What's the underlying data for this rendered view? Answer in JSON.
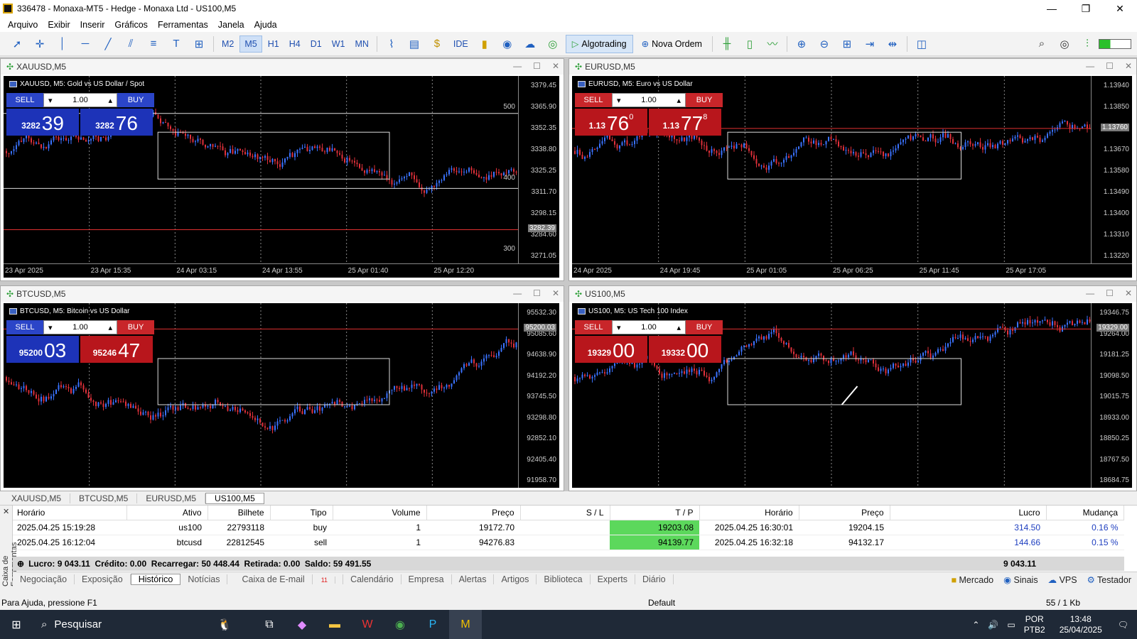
{
  "window": {
    "title": "336478 - Monaxa-MT5 - Hedge - Monaxa Ltd - US100,M5",
    "minimize": "—",
    "restore": "❐",
    "close": "✕"
  },
  "menu": [
    "Arquivo",
    "Exibir",
    "Inserir",
    "Gráficos",
    "Ferramentas",
    "Janela",
    "Ajuda"
  ],
  "toolbar": {
    "timeframes": [
      "M2",
      "M5",
      "H1",
      "H4",
      "D1",
      "W1",
      "MN"
    ],
    "active_tf": "M5",
    "ide": "IDE",
    "algotrading": "Algotrading",
    "nova_ordem": "Nova Ordem"
  },
  "charts": [
    {
      "id": "xau",
      "caption": "XAUUSD,M5",
      "symbol_label": "XAUUSD, M5:  Gold vs US Dollar / Spot",
      "style": "blue",
      "lot": "1.00",
      "sell": "SELL",
      "buy": "BUY",
      "sell_small": "3282",
      "sell_big": "39",
      "sell_sup": "",
      "buy_small": "3282",
      "buy_big": "76",
      "buy_sup": "",
      "yticks": [
        "3379.45",
        "3365.90",
        "3352.35",
        "3338.80",
        "3325.25",
        "3311.70",
        "3298.15",
        "3284.60",
        "3271.05"
      ],
      "current": "3282.39",
      "xticks": [
        "23 Apr 2025",
        "23 Apr 15:35",
        "24 Apr 03:15",
        "24 Apr 13:55",
        "25 Apr 01:40",
        "25 Apr 12:20"
      ],
      "levels": [
        "500",
        "400",
        "300"
      ]
    },
    {
      "id": "eur",
      "caption": "EURUSD,M5",
      "symbol_label": "EURUSD, M5:  Euro vs US Dollar",
      "style": "red",
      "lot": "1.00",
      "sell": "SELL",
      "buy": "BUY",
      "sell_small": "1.13",
      "sell_big": "76",
      "sell_sup": "0",
      "buy_small": "1.13",
      "buy_big": "77",
      "buy_sup": "8",
      "yticks": [
        "1.13940",
        "1.13850",
        "1.13760",
        "1.13670",
        "1.13580",
        "1.13490",
        "1.13400",
        "1.13310",
        "1.13220"
      ],
      "current": "1.13760",
      "xticks": [
        "24 Apr 2025",
        "24 Apr 19:45",
        "25 Apr 01:05",
        "25 Apr 06:25",
        "25 Apr 11:45",
        "25 Apr 17:05"
      ],
      "levels": []
    },
    {
      "id": "btc",
      "caption": "BTCUSD,M5",
      "symbol_label": "BTCUSD, M5:  Bitcoin vs US Dollar",
      "style": "mix",
      "lot": "1.00",
      "sell": "SELL",
      "buy": "BUY",
      "sell_small": "95200",
      "sell_big": "03",
      "sell_sup": "",
      "buy_small": "95246",
      "buy_big": "47",
      "buy_sup": "",
      "yticks": [
        "95532.30",
        "95085.60",
        "94638.90",
        "94192.20",
        "93745.50",
        "93298.80",
        "92852.10",
        "92405.40",
        "91958.70"
      ],
      "current": "95200.03",
      "xticks": [],
      "levels": []
    },
    {
      "id": "us100",
      "caption": "US100,M5",
      "symbol_label": "US100, M5:  US Tech 100 Index",
      "style": "red",
      "lot": "1.00",
      "sell": "SELL",
      "buy": "BUY",
      "sell_small": "19329",
      "sell_big": "00",
      "sell_sup": "",
      "buy_small": "19332",
      "buy_big": "00",
      "buy_sup": "",
      "yticks": [
        "19346.75",
        "19264.00",
        "19181.25",
        "19098.50",
        "19015.75",
        "18933.00",
        "18850.25",
        "18767.50",
        "18684.75"
      ],
      "current": "19329.00",
      "xticks": [],
      "levels": []
    }
  ],
  "chart_tabs": [
    "XAUUSD,M5",
    "BTCUSD,M5",
    "EURUSD,M5",
    "US100,M5"
  ],
  "active_chart_tab": "US100,M5",
  "history": {
    "side_label": "Caixa de Ferramentas",
    "headers": [
      "Horário",
      "Ativo",
      "Bilhete",
      "Tipo",
      "Volume",
      "Preço",
      "S / L",
      "T / P",
      "Horário",
      "Preço",
      "Lucro",
      "Mudança"
    ],
    "rows": [
      [
        "2025.04.25 15:19:28",
        "us100",
        "22793118",
        "buy",
        "1",
        "19172.70",
        "",
        "19203.08",
        "2025.04.25 16:30:01",
        "19204.15",
        "314.50",
        "0.16 %"
      ],
      [
        "2025.04.25 16:12:04",
        "btcusd",
        "22812545",
        "sell",
        "1",
        "94276.83",
        "",
        "94139.77",
        "2025.04.25 16:32:18",
        "94132.17",
        "144.66",
        "0.15 %"
      ]
    ],
    "summary": "Lucro: 9 043.11  Crédito: 0.00  Recarregar: 50 448.44  Retirada: 0.00  Saldo: 59 491.55",
    "summary_total": "9 043.11"
  },
  "toolbox_tabs": [
    "Negociação",
    "Exposição",
    "Histórico",
    "Notícias",
    "Caixa de E-mail",
    "Calendário",
    "Empresa",
    "Alertas",
    "Artigos",
    "Biblioteca",
    "Experts",
    "Diário"
  ],
  "active_toolbox_tab": "Histórico",
  "mail_badge": "11",
  "toolbox_right": [
    "Mercado",
    "Sinais",
    "VPS",
    "Testador"
  ],
  "status": {
    "help": "Para Ajuda, pressione F1",
    "profile": "Default",
    "traffic": "55 / 1 Kb"
  },
  "taskbar": {
    "search": "Pesquisar",
    "lang1": "POR",
    "lang2": "PTB2",
    "time": "13:48",
    "date": "25/04/2025"
  }
}
